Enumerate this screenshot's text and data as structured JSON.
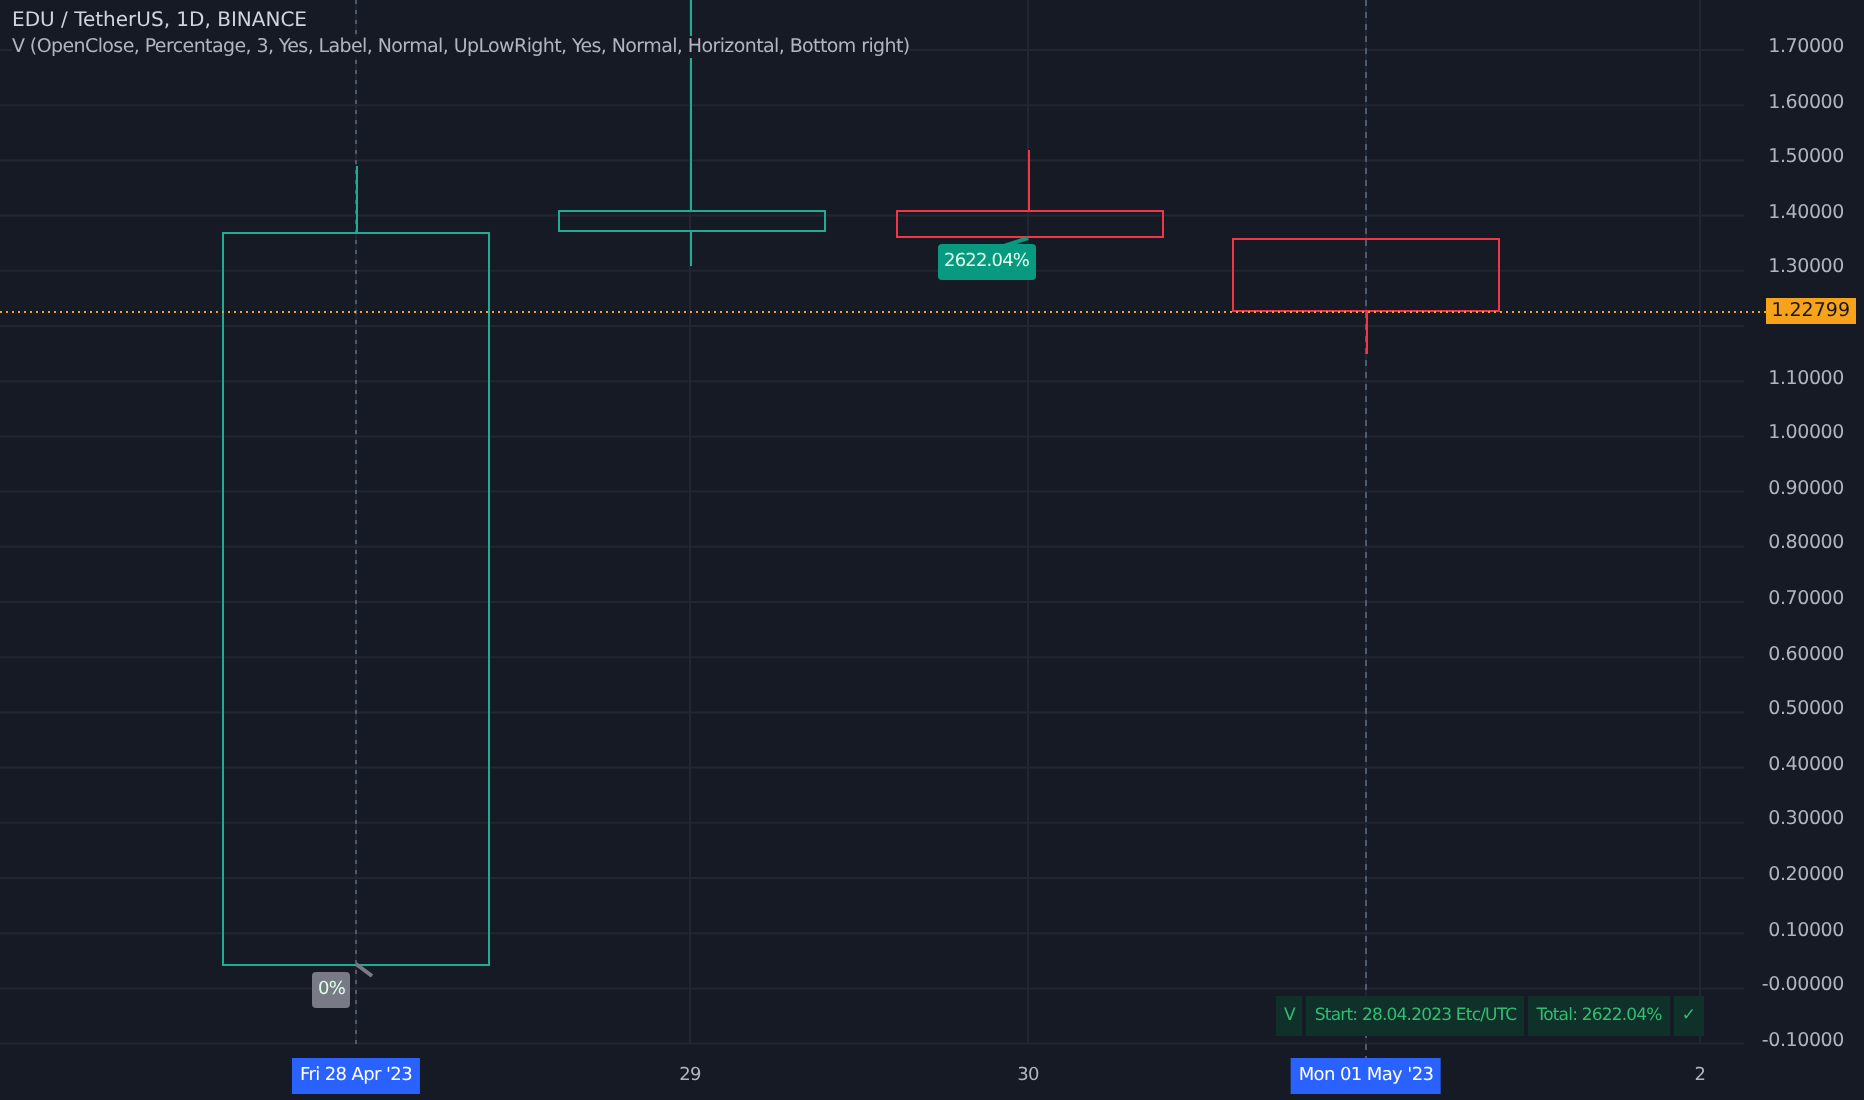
{
  "legend": {
    "title": "EDU / TetherUS, 1D, BINANCE",
    "indicator": "V (OpenClose, Percentage, 3, Yes, Label, Normal, UpLowRight, Yes, Normal, Horizontal, Bottom right)"
  },
  "price_axis": {
    "ticks": [
      "1.70000",
      "1.60000",
      "1.50000",
      "1.40000",
      "1.30000",
      "1.10000",
      "1.00000",
      "0.90000",
      "0.80000",
      "0.70000",
      "0.60000",
      "0.50000",
      "0.40000",
      "0.30000",
      "0.20000",
      "0.10000",
      "-0.00000",
      "-0.10000"
    ],
    "current_price": "1.22799"
  },
  "time_axis": [
    {
      "label": "Fri 28 Apr '23",
      "highlighted": true
    },
    {
      "label": "29",
      "highlighted": false
    },
    {
      "label": "30",
      "highlighted": false
    },
    {
      "label": "Mon 01 May '23",
      "highlighted": true
    },
    {
      "label": "2",
      "highlighted": false
    }
  ],
  "markers": [
    {
      "text": "2622.04%",
      "kind": "gain"
    },
    {
      "text": "0%",
      "kind": "neutral"
    }
  ],
  "summary_table": {
    "cells": [
      "V",
      "Start: 28.04.2023 Etc/UTC",
      "Total: 2622.04%",
      "✓"
    ]
  }
}
